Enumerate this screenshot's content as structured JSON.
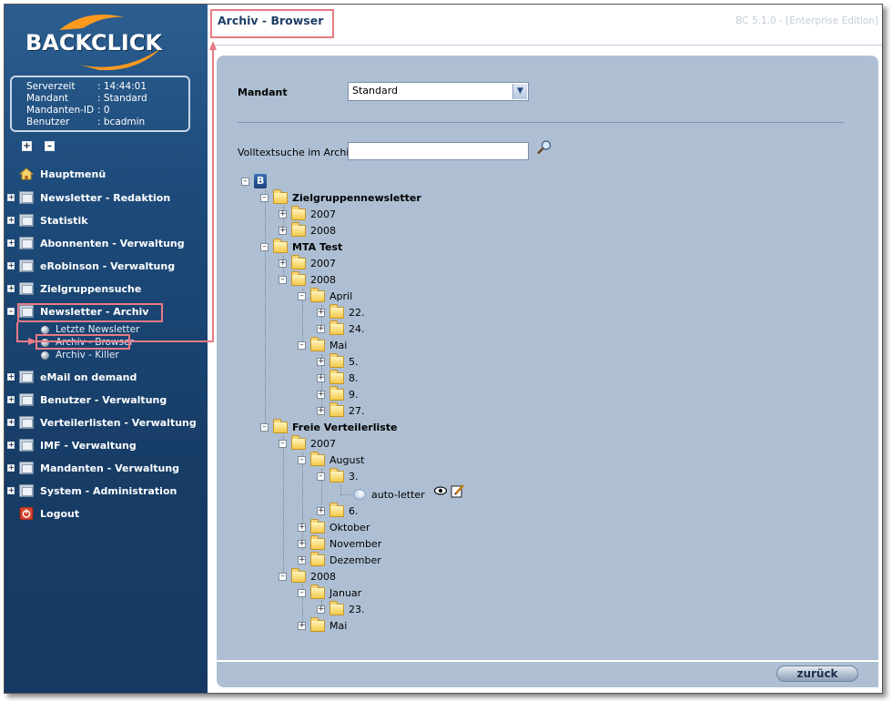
{
  "app": {
    "logo_text": "BACKCLICK",
    "version": "BC 5.1.0 - [Enterprise Edition]"
  },
  "info": {
    "rows": [
      {
        "label": "Serverzeit",
        "value": ": 14:44:01"
      },
      {
        "label": "Mandant",
        "value": ": Standard"
      },
      {
        "label": "Mandanten-ID",
        "value": ": 0"
      },
      {
        "label": "Benutzer",
        "value": ": bcadmin"
      }
    ]
  },
  "nav": {
    "items": [
      {
        "label": "Hauptmenü",
        "icon": "home-icon"
      },
      {
        "label": "Newsletter - Redaktion",
        "icon": "folder-icon"
      },
      {
        "label": "Statistik",
        "icon": "folder-icon"
      },
      {
        "label": "Abonnenten - Verwaltung",
        "icon": "folder-icon"
      },
      {
        "label": "eRobinson - Verwaltung",
        "icon": "folder-icon"
      },
      {
        "label": "Zielgruppensuche",
        "icon": "folder-icon"
      },
      {
        "label": "Newsletter - Archiv",
        "icon": "folder-icon"
      },
      {
        "label": "eMail on demand",
        "icon": "folder-icon"
      },
      {
        "label": "Benutzer - Verwaltung",
        "icon": "folder-icon"
      },
      {
        "label": "Verteilerlisten - Verwaltung",
        "icon": "folder-icon"
      },
      {
        "label": "IMF - Verwaltung",
        "icon": "folder-icon"
      },
      {
        "label": "Mandanten - Verwaltung",
        "icon": "folder-icon"
      },
      {
        "label": "System - Administration",
        "icon": "folder-icon"
      },
      {
        "label": "Logout",
        "icon": "power-icon"
      }
    ],
    "archive_sub": [
      {
        "label": "Letzte Newsletter"
      },
      {
        "label": "Archiv - Browser"
      },
      {
        "label": "Archiv - Killer"
      }
    ]
  },
  "page": {
    "title": "Archiv - Browser",
    "mandant_label": "Mandant",
    "mandant_value": "Standard",
    "search_label": "Volltextsuche im Archiv:",
    "search_value": "",
    "back_button": "zurück"
  },
  "tree": {
    "nodes": [
      {
        "label": "Zielgruppennewsletter",
        "bold": true
      },
      {
        "label": "2007"
      },
      {
        "label": "2008"
      },
      {
        "label": "MTA Test",
        "bold": true
      },
      {
        "label": "2007"
      },
      {
        "label": "2008"
      },
      {
        "label": "April"
      },
      {
        "label": "22."
      },
      {
        "label": "24."
      },
      {
        "label": "Mai"
      },
      {
        "label": "5."
      },
      {
        "label": "8."
      },
      {
        "label": "9."
      },
      {
        "label": "27."
      },
      {
        "label": "Freie Verteilerliste",
        "bold": true
      },
      {
        "label": "2007"
      },
      {
        "label": "August"
      },
      {
        "label": "3."
      },
      {
        "label": "auto-letter"
      },
      {
        "label": "6."
      },
      {
        "label": "Oktober"
      },
      {
        "label": "November"
      },
      {
        "label": "Dezember"
      },
      {
        "label": "2008"
      },
      {
        "label": "Januar"
      },
      {
        "label": "23."
      },
      {
        "label": "Mai"
      }
    ]
  },
  "colors": {
    "sidebar": "#1d4b7b",
    "panel": "#aebfd3",
    "title": "#1f3e66",
    "highlight": "#e87a86"
  }
}
